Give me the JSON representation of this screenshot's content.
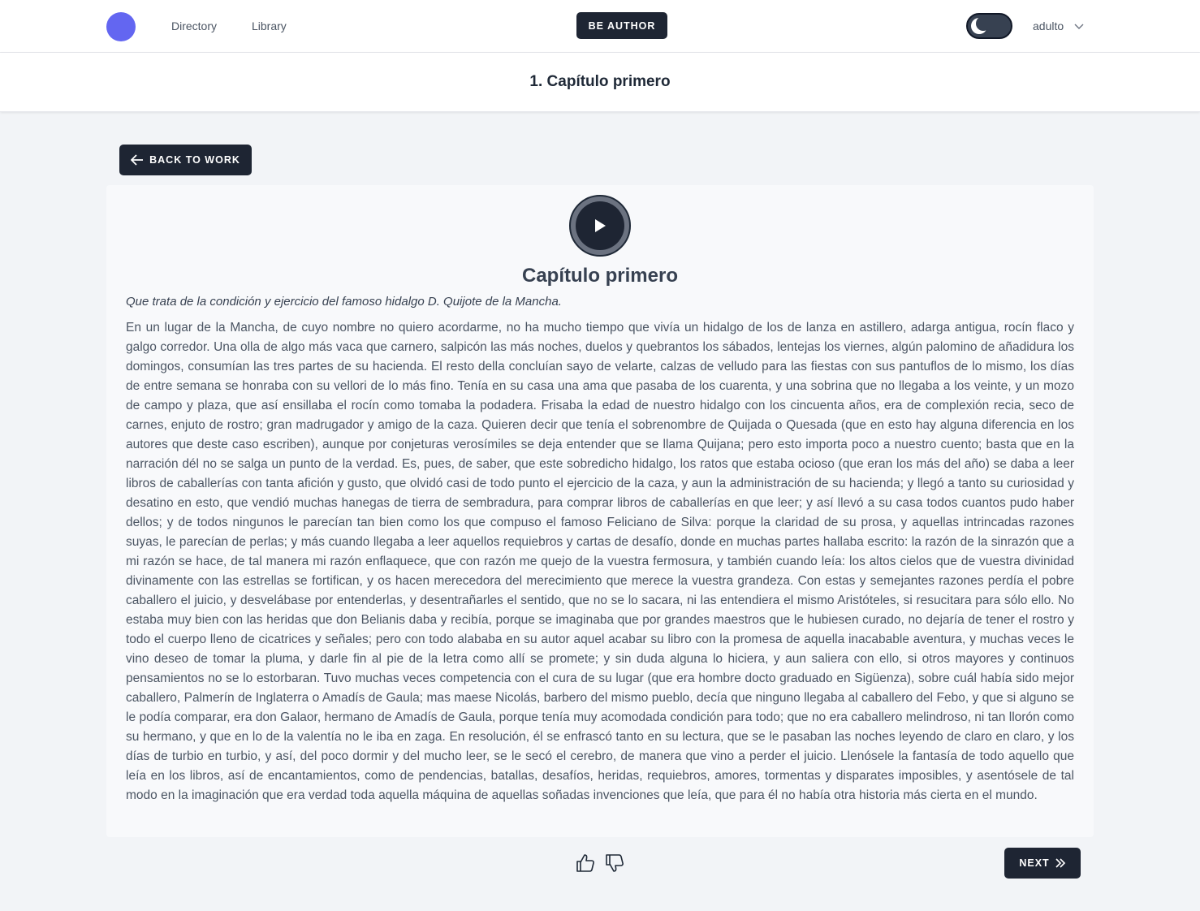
{
  "nav": {
    "links": [
      "Directory",
      "Library"
    ],
    "be_author_label": "BE AUTHOR",
    "user_label": "adulto",
    "theme": "dark-mode-toggle"
  },
  "chapter_header": {
    "title": "1. Capítulo primero"
  },
  "back_button_label": "BACK TO WORK",
  "content": {
    "title": "Capítulo primero",
    "subtitle": "Que trata de la condición y ejercicio del famoso hidalgo D. Quijote de la Mancha.",
    "body": "En un lugar de la Mancha, de cuyo nombre no quiero acordarme, no ha mucho tiempo que vivía un hidalgo de los de lanza en astillero, adarga antigua, rocín flaco y galgo corredor. Una olla de algo más vaca que carnero, salpicón las más noches, duelos y quebrantos los sábados, lentejas los viernes, algún palomino de añadidura los domingos, consumían las tres partes de su hacienda. El resto della concluían sayo de velarte, calzas de velludo para las fiestas con sus pantuflos de lo mismo, los días de entre semana se honraba con su vellori de lo más fino. Tenía en su casa una ama que pasaba de los cuarenta, y una sobrina que no llegaba a los veinte, y un mozo de campo y plaza, que así ensillaba el rocín como tomaba la podadera. Frisaba la edad de nuestro hidalgo con los cincuenta años, era de complexión recia, seco de carnes, enjuto de rostro; gran madrugador y amigo de la caza. Quieren decir que tenía el sobrenombre de Quijada o Quesada (que en esto hay alguna diferencia en los autores que deste caso escriben), aunque por conjeturas verosímiles se deja entender que se llama Quijana; pero esto importa poco a nuestro cuento; basta que en la narración dél no se salga un punto de la verdad. Es, pues, de saber, que este sobredicho hidalgo, los ratos que estaba ocioso (que eran los más del año) se daba a leer libros de caballerías con tanta afición y gusto, que olvidó casi de todo punto el ejercicio de la caza, y aun la administración de su hacienda; y llegó a tanto su curiosidad y desatino en esto, que vendió muchas hanegas de tierra de sembradura, para comprar libros de caballerías en que leer; y así llevó a su casa todos cuantos pudo haber dellos; y de todos ningunos le parecían tan bien como los que compuso el famoso Feliciano de Silva: porque la claridad de su prosa, y aquellas intrincadas razones suyas, le parecían de perlas; y más cuando llegaba a leer aquellos requiebros y cartas de desafío, donde en muchas partes hallaba escrito: la razón de la sinrazón que a mi razón se hace, de tal manera mi razón enflaquece, que con razón me quejo de la vuestra fermosura, y también cuando leía: los altos cielos que de vuestra divinidad divinamente con las estrellas se fortifican, y os hacen merecedora del merecimiento que merece la vuestra grandeza. Con estas y semejantes razones perdía el pobre caballero el juicio, y desvelábase por entenderlas, y desentrañarles el sentido, que no se lo sacara, ni las entendiera el mismo Aristóteles, si resucitara para sólo ello. No estaba muy bien con las heridas que don Belianis daba y recibía, porque se imaginaba que por grandes maestros que le hubiesen curado, no dejaría de tener el rostro y todo el cuerpo lleno de cicatrices y señales; pero con todo alababa en su autor aquel acabar su libro con la promesa de aquella inacabable aventura, y muchas veces le vino deseo de tomar la pluma, y darle fin al pie de la letra como allí se promete; y sin duda alguna lo hiciera, y aun saliera con ello, si otros mayores y continuos pensamientos no se lo estorbaran. Tuvo muchas veces competencia con el cura de su lugar (que era hombre docto graduado en Sigüenza), sobre cuál había sido mejor caballero, Palmerín de Inglaterra o Amadís de Gaula; mas maese Nicolás, barbero del mismo pueblo, decía que ninguno llegaba al caballero del Febo, y que si alguno se le podía comparar, era don Galaor, hermano de Amadís de Gaula, porque tenía muy acomodada condición para todo; que no era caballero melindroso, ni tan llorón como su hermano, y que en lo de la valentía no le iba en zaga. En resolución, él se enfrascó tanto en su lectura, que se le pasaban las noches leyendo de claro en claro, y los días de turbio en turbio, y así, del poco dormir y del mucho leer, se le secó el cerebro, de manera que vino a perder el juicio. Llenósele la fantasía de todo aquello que leía en los libros, así de encantamientos, como de pendencias, batallas, desafíos, heridas, requiebros, amores, tormentas y disparates imposibles, y asentósele de tal modo en la imaginación que era verdad toda aquella máquina de aquellas soñadas invenciones que leía, que para él no había otra historia más cierta en el mundo."
  },
  "footer": {
    "next_label": "NEXT"
  },
  "colors": {
    "accent": "#6366f1",
    "button_dark": "#1e2533",
    "background": "#f2f4f7"
  },
  "icons": [
    "logo-icon",
    "moon-icon",
    "chevron-down-icon",
    "arrow-left-icon",
    "play-icon",
    "thumbs-up-icon",
    "thumbs-down-icon",
    "double-chevron-right-icon"
  ]
}
